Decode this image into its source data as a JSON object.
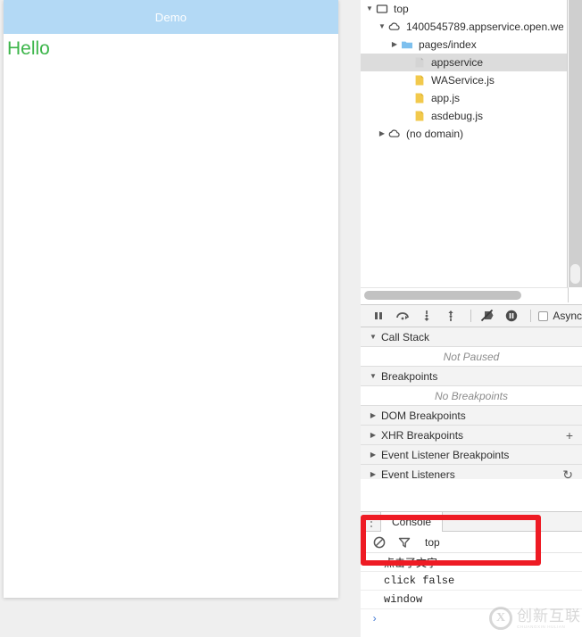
{
  "simulator": {
    "title": "Demo",
    "content": "Hello",
    "header_bg": "#b3d9f5",
    "text_color": "#3cb54a"
  },
  "devtools": {
    "navigator": {
      "tree": [
        {
          "label": "top",
          "icon": "frame-icon",
          "twisty": "▼",
          "indent": 0,
          "selected": false
        },
        {
          "label": "1400545789.appservice.open.we",
          "icon": "cloud-icon",
          "twisty": "▼",
          "indent": 1,
          "selected": false
        },
        {
          "label": "pages/index",
          "icon": "folder-icon",
          "twisty": "▶",
          "indent": 2,
          "selected": false
        },
        {
          "label": "appservice",
          "icon": "document-icon",
          "twisty": "",
          "indent": 3,
          "selected": true
        },
        {
          "label": "WAService.js",
          "icon": "js-file-icon",
          "twisty": "",
          "indent": 3,
          "selected": false
        },
        {
          "label": "app.js",
          "icon": "js-file-icon",
          "twisty": "",
          "indent": 3,
          "selected": false
        },
        {
          "label": "asdebug.js",
          "icon": "js-file-icon",
          "twisty": "",
          "indent": 3,
          "selected": false
        },
        {
          "label": "(no domain)",
          "icon": "cloud-icon",
          "twisty": "▶",
          "indent": 1,
          "selected": false
        }
      ]
    },
    "debugger_toolbar": {
      "buttons": [
        {
          "name": "pause-resume-button",
          "icon": "pause-icon"
        },
        {
          "name": "step-over-button",
          "icon": "step-over-icon"
        },
        {
          "name": "step-into-button",
          "icon": "step-into-icon"
        },
        {
          "name": "step-out-button",
          "icon": "step-out-icon"
        },
        {
          "name": "deactivate-breakpoints-button",
          "icon": "breakpoint-slash-icon"
        },
        {
          "name": "pause-on-exceptions-button",
          "icon": "pause-circle-icon"
        }
      ],
      "async_label": "Async",
      "async_checked": false
    },
    "sections": [
      {
        "name": "call-stack",
        "title": "Call Stack",
        "twisty": "▼",
        "empty_text": "Not Paused",
        "action": ""
      },
      {
        "name": "breakpoints",
        "title": "Breakpoints",
        "twisty": "▼",
        "empty_text": "No Breakpoints",
        "action": ""
      },
      {
        "name": "dom-breakpoints",
        "title": "DOM Breakpoints",
        "twisty": "▶",
        "empty_text": "",
        "action": ""
      },
      {
        "name": "xhr-breakpoints",
        "title": "XHR Breakpoints",
        "twisty": "▶",
        "empty_text": "",
        "action": "+"
      },
      {
        "name": "event-listener-breakpoints",
        "title": "Event Listener Breakpoints",
        "twisty": "▶",
        "empty_text": "",
        "action": ""
      },
      {
        "name": "event-listeners",
        "title": "Event Listeners",
        "twisty": "▶",
        "empty_text": "",
        "action": "↻"
      }
    ],
    "drawer": {
      "tab_label": "Console",
      "clear_icon": "clear-console-icon",
      "filter_icon": "filter-funnel-icon",
      "context": "top",
      "messages": [
        {
          "text": "点击了文字",
          "mono": false
        },
        {
          "text": "click false",
          "mono": true
        },
        {
          "text": "window",
          "mono": true
        }
      ],
      "prompt": "›"
    }
  },
  "annotation": {
    "color": "#ee1b24"
  },
  "watermark": {
    "mark": "X",
    "cn": "创新互联",
    "en": "CHUANGXIN HULIAN"
  }
}
